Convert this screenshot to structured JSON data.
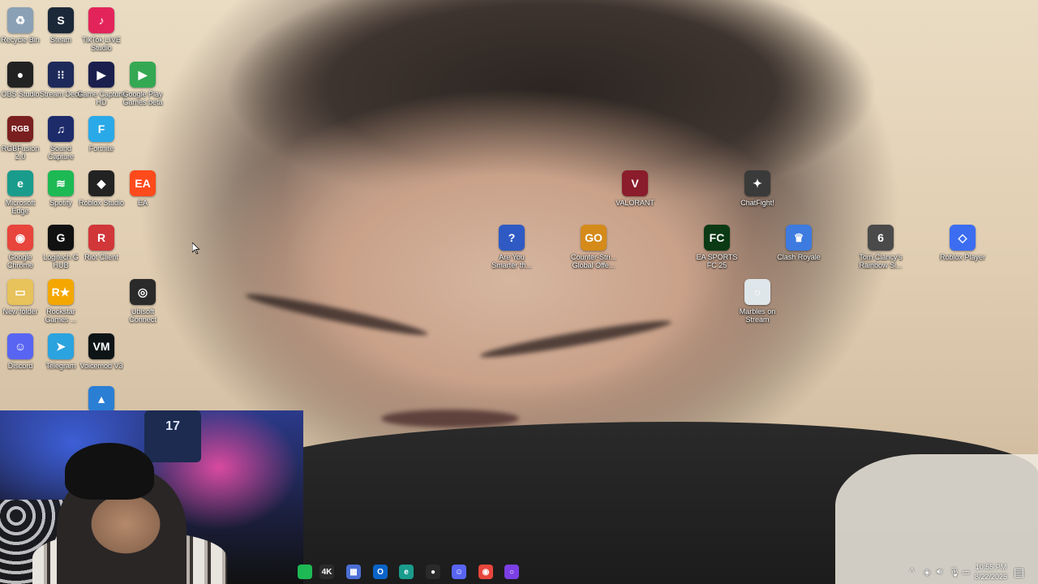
{
  "desktop": {
    "icons": [
      {
        "label": "Recycle Bin",
        "icon": "recycle-bin-icon",
        "color": "#8aa0b5",
        "glyph": "♻"
      },
      {
        "label": "Steam",
        "icon": "steam-icon",
        "color": "#1b2838",
        "glyph": "S"
      },
      {
        "label": "TikTok LIVE Studio",
        "icon": "tiktok-icon",
        "color": "#e3245a",
        "glyph": "♪"
      },
      {
        "label": "OBS Studio",
        "icon": "obs-icon",
        "color": "#222222",
        "glyph": "●"
      },
      {
        "label": "Stream Deck",
        "icon": "stream-deck-icon",
        "color": "#1e2a5a",
        "glyph": "⁝⁝"
      },
      {
        "label": "Game Capture HD",
        "icon": "game-capture-icon",
        "color": "#1a1f4d",
        "glyph": "▶"
      },
      {
        "label": "Google Play Games beta",
        "icon": "google-play-games-icon",
        "color": "#34a853",
        "glyph": "▶"
      },
      {
        "label": "RGBFusion 2.0",
        "icon": "rgbfusion-icon",
        "color": "#7a1f1f",
        "glyph": "RGB"
      },
      {
        "label": "Sound Capture",
        "icon": "sound-capture-icon",
        "color": "#1d2b6b",
        "glyph": "♫"
      },
      {
        "label": "Fortnite",
        "icon": "fortnite-icon",
        "color": "#2aa9e8",
        "glyph": "F"
      },
      {
        "label": "Microsoft Edge",
        "icon": "edge-icon",
        "color": "#1a9c8c",
        "glyph": "e"
      },
      {
        "label": "Spotify",
        "icon": "spotify-icon",
        "color": "#1db954",
        "glyph": "≋"
      },
      {
        "label": "Roblox Studio",
        "icon": "roblox-studio-icon",
        "color": "#222222",
        "glyph": "◆"
      },
      {
        "label": "EA",
        "icon": "ea-icon",
        "color": "#ff4a1c",
        "glyph": "EA"
      },
      {
        "label": "Google Chrome",
        "icon": "chrome-icon",
        "color": "#e8453c",
        "glyph": "◉"
      },
      {
        "label": "Logitech G HUB",
        "icon": "logitech-icon",
        "color": "#111111",
        "glyph": "G"
      },
      {
        "label": "Riot Client",
        "icon": "riot-client-icon",
        "color": "#d13639",
        "glyph": "R"
      },
      {
        "label": "New folder",
        "icon": "folder-icon",
        "color": "#e8c25a",
        "glyph": "▭"
      },
      {
        "label": "Rockstar Games ...",
        "icon": "rockstar-icon",
        "color": "#f4a700",
        "glyph": "R★"
      },
      {
        "label": "Ubisoft Connect",
        "icon": "ubisoft-icon",
        "color": "#2a2a2a",
        "glyph": "◎"
      },
      {
        "label": "Discord",
        "icon": "discord-icon",
        "color": "#5865f2",
        "glyph": "☺"
      },
      {
        "label": "Telegram",
        "icon": "telegram-icon",
        "color": "#2aa3df",
        "glyph": "➤"
      },
      {
        "label": "Voicemod V3",
        "icon": "voicemod-icon",
        "color": "#0d1416",
        "glyph": "VM"
      },
      {
        "label": "",
        "icon": "app-icon",
        "color": "#2a7fd4",
        "glyph": "▲"
      },
      {
        "label": "VALORANT",
        "icon": "valorant-icon",
        "color": "#8a1c2b",
        "glyph": "V"
      },
      {
        "label": "ChatFight!",
        "icon": "chatfight-icon",
        "color": "#3a3a3a",
        "glyph": "✦"
      },
      {
        "label": "Are You Smarter th...",
        "icon": "are-you-smarter-icon",
        "color": "#2f5ac4",
        "glyph": "?"
      },
      {
        "label": "Counter-Stri... Global Offe...",
        "icon": "csgo-icon",
        "color": "#d48b1a",
        "glyph": "GO"
      },
      {
        "label": "EA SPORTS FC 25",
        "icon": "ea-fc25-icon",
        "color": "#0b3a14",
        "glyph": "FC"
      },
      {
        "label": "Clash Royale",
        "icon": "clash-royale-icon",
        "color": "#3d7be0",
        "glyph": "♛"
      },
      {
        "label": "Tom Clancy's Rainbow Si...",
        "icon": "rainbow-six-icon",
        "color": "#4a4a4a",
        "glyph": "6"
      },
      {
        "label": "Roblox Player",
        "icon": "roblox-player-icon",
        "color": "#3c6df0",
        "glyph": "◇"
      },
      {
        "label": "Marbles on Stream",
        "icon": "marbles-icon",
        "color": "#dfe6ea",
        "glyph": "○"
      }
    ]
  },
  "webcam": {
    "jersey_number": "17"
  },
  "taskbar": {
    "apps": [
      {
        "icon": "spotify-taskbar-icon",
        "color": "#1db954",
        "glyph": ""
      },
      {
        "icon": "4k-capture-icon",
        "color": "#2b2b2b",
        "glyph": "4K"
      },
      {
        "icon": "photos-icon",
        "color": "#4b6fd6",
        "glyph": "▦"
      },
      {
        "icon": "outlook-icon",
        "color": "#0a64c8",
        "glyph": "O"
      },
      {
        "icon": "edge-taskbar-icon",
        "color": "#1a9c8c",
        "glyph": "e"
      },
      {
        "icon": "obs-taskbar-icon",
        "color": "#2a2a2a",
        "glyph": "●"
      },
      {
        "icon": "discord-taskbar-icon",
        "color": "#5865f2",
        "glyph": "☺"
      },
      {
        "icon": "chrome-taskbar-icon",
        "color": "#e8453c",
        "glyph": "◉"
      },
      {
        "icon": "app-taskbar-icon",
        "color": "#7b3fe4",
        "glyph": "○"
      }
    ],
    "tray": {
      "chevron": "^",
      "clock_time": "10:55 PM",
      "clock_date": "8/22/2025"
    }
  }
}
